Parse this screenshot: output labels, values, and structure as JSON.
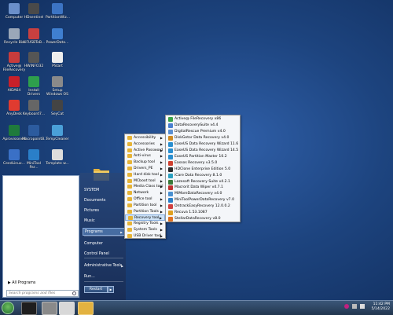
{
  "desktop_icons": [
    {
      "label": "Computer",
      "color": "#6b8fc9"
    },
    {
      "label": "HDsentinel",
      "color": "#4a4a4a"
    },
    {
      "label": "PartitionWiz...",
      "color": "#3c74c4"
    },
    {
      "label": "Recycle Bin",
      "color": "#9aa7b8"
    },
    {
      "label": "HiFUSBToB...",
      "color": "#c84040"
    },
    {
      "label": "PowerData...",
      "color": "#3f7fd0"
    },
    {
      "label": "Active@ FileRecovery",
      "color": "#c83c3c"
    },
    {
      "label": "HWINFO32",
      "color": "#555555"
    },
    {
      "label": "PStart",
      "color": "#eeeeee"
    },
    {
      "label": "AIDA64",
      "color": "#c8202a"
    },
    {
      "label": "Install Drivers",
      "color": "#2e9f4c"
    },
    {
      "label": "Setup Windows OS",
      "color": "#8a8a8a"
    },
    {
      "label": "AnyDesk",
      "color": "#e03b30"
    },
    {
      "label": "Keyboard7...",
      "color": "#666666"
    },
    {
      "label": "SeyCat",
      "color": "#444444"
    },
    {
      "label": "Aprovisioned",
      "color": "#1f7a3c"
    },
    {
      "label": "MacropointB...",
      "color": "#2c5b9e"
    },
    {
      "label": "TempCleaner",
      "color": "#4aa0d8"
    },
    {
      "label": "CeedLinux...",
      "color": "#3a70c6"
    },
    {
      "label": "MiniTool Par...",
      "color": "#2a7fc8"
    },
    {
      "label": "Template w...",
      "color": "#dddddd"
    }
  ],
  "start_menu": {
    "right_items": [
      "SYSTEM",
      "Documents",
      "Pictures",
      "Music",
      "Programs",
      "Computer",
      "Control Panel",
      "Administrative Tools",
      "Run..."
    ],
    "all_programs": "All Programs",
    "search_placeholder": "Search programs and files",
    "restart_label": "Restart",
    "restart_arrow": "▶"
  },
  "programs_menu": {
    "items": [
      "Accessibility",
      "Accessories",
      "Active Password",
      "Anti-virus",
      "Backup tool",
      "Drivers_PE",
      "Hard disk tool",
      "MCboot tool",
      "Media Class tool",
      "Network",
      "Office tool",
      "Partition tool",
      "Partition Tools",
      "Recovery tool",
      "Registry Tools",
      "System Tools",
      "USB Driver tool"
    ],
    "highlighted": "Recovery tool"
  },
  "recovery_menu": {
    "items": [
      {
        "label": "Active@ FileRecovery x86",
        "color": "#3aa34a"
      },
      {
        "label": "DataRecoverySuite v4.4",
        "color": "#4a7fd0"
      },
      {
        "label": "DigitalRescue Premium v4.0",
        "color": "#5a8fd0"
      },
      {
        "label": "DiskGetor Data Recovery v4.0",
        "color": "#d08a20"
      },
      {
        "label": "EaseUS Data Recovery Wizard 11.6",
        "color": "#2a8fd0"
      },
      {
        "label": "EaseUS Data Recovery Wizard 14.5",
        "color": "#2a8fd0"
      },
      {
        "label": "EaseUS Partition Master 10.2",
        "color": "#2a8fd0"
      },
      {
        "label": "Eassos Recovery v3.5.0",
        "color": "#d04030"
      },
      {
        "label": "HDClone Enterprise Edition 5.0",
        "color": "#2a2a2a"
      },
      {
        "label": "iCare Data Recovery 8.1.0",
        "color": "#2aa0c0"
      },
      {
        "label": "Lazesoft Recovery Suite v4.2.1",
        "color": "#3a7a3a"
      },
      {
        "label": "Macrorit Data Wiper v4.7.1",
        "color": "#c03030"
      },
      {
        "label": "MiMoreDataRecovery v4.0",
        "color": "#4a90d0"
      },
      {
        "label": "MiniToolPowerDataRecovery v7.0",
        "color": "#2a7fc8"
      },
      {
        "label": "OntrackEasyRecovery 12.0.0.2",
        "color": "#d04040"
      },
      {
        "label": "Recuva 1.53.1087",
        "color": "#e0a020"
      },
      {
        "label": "StellarDataRecovery v8.0",
        "color": "#e07020"
      }
    ]
  },
  "taskbar": {
    "time": "11:42 PM",
    "date": "5/14/2022"
  }
}
